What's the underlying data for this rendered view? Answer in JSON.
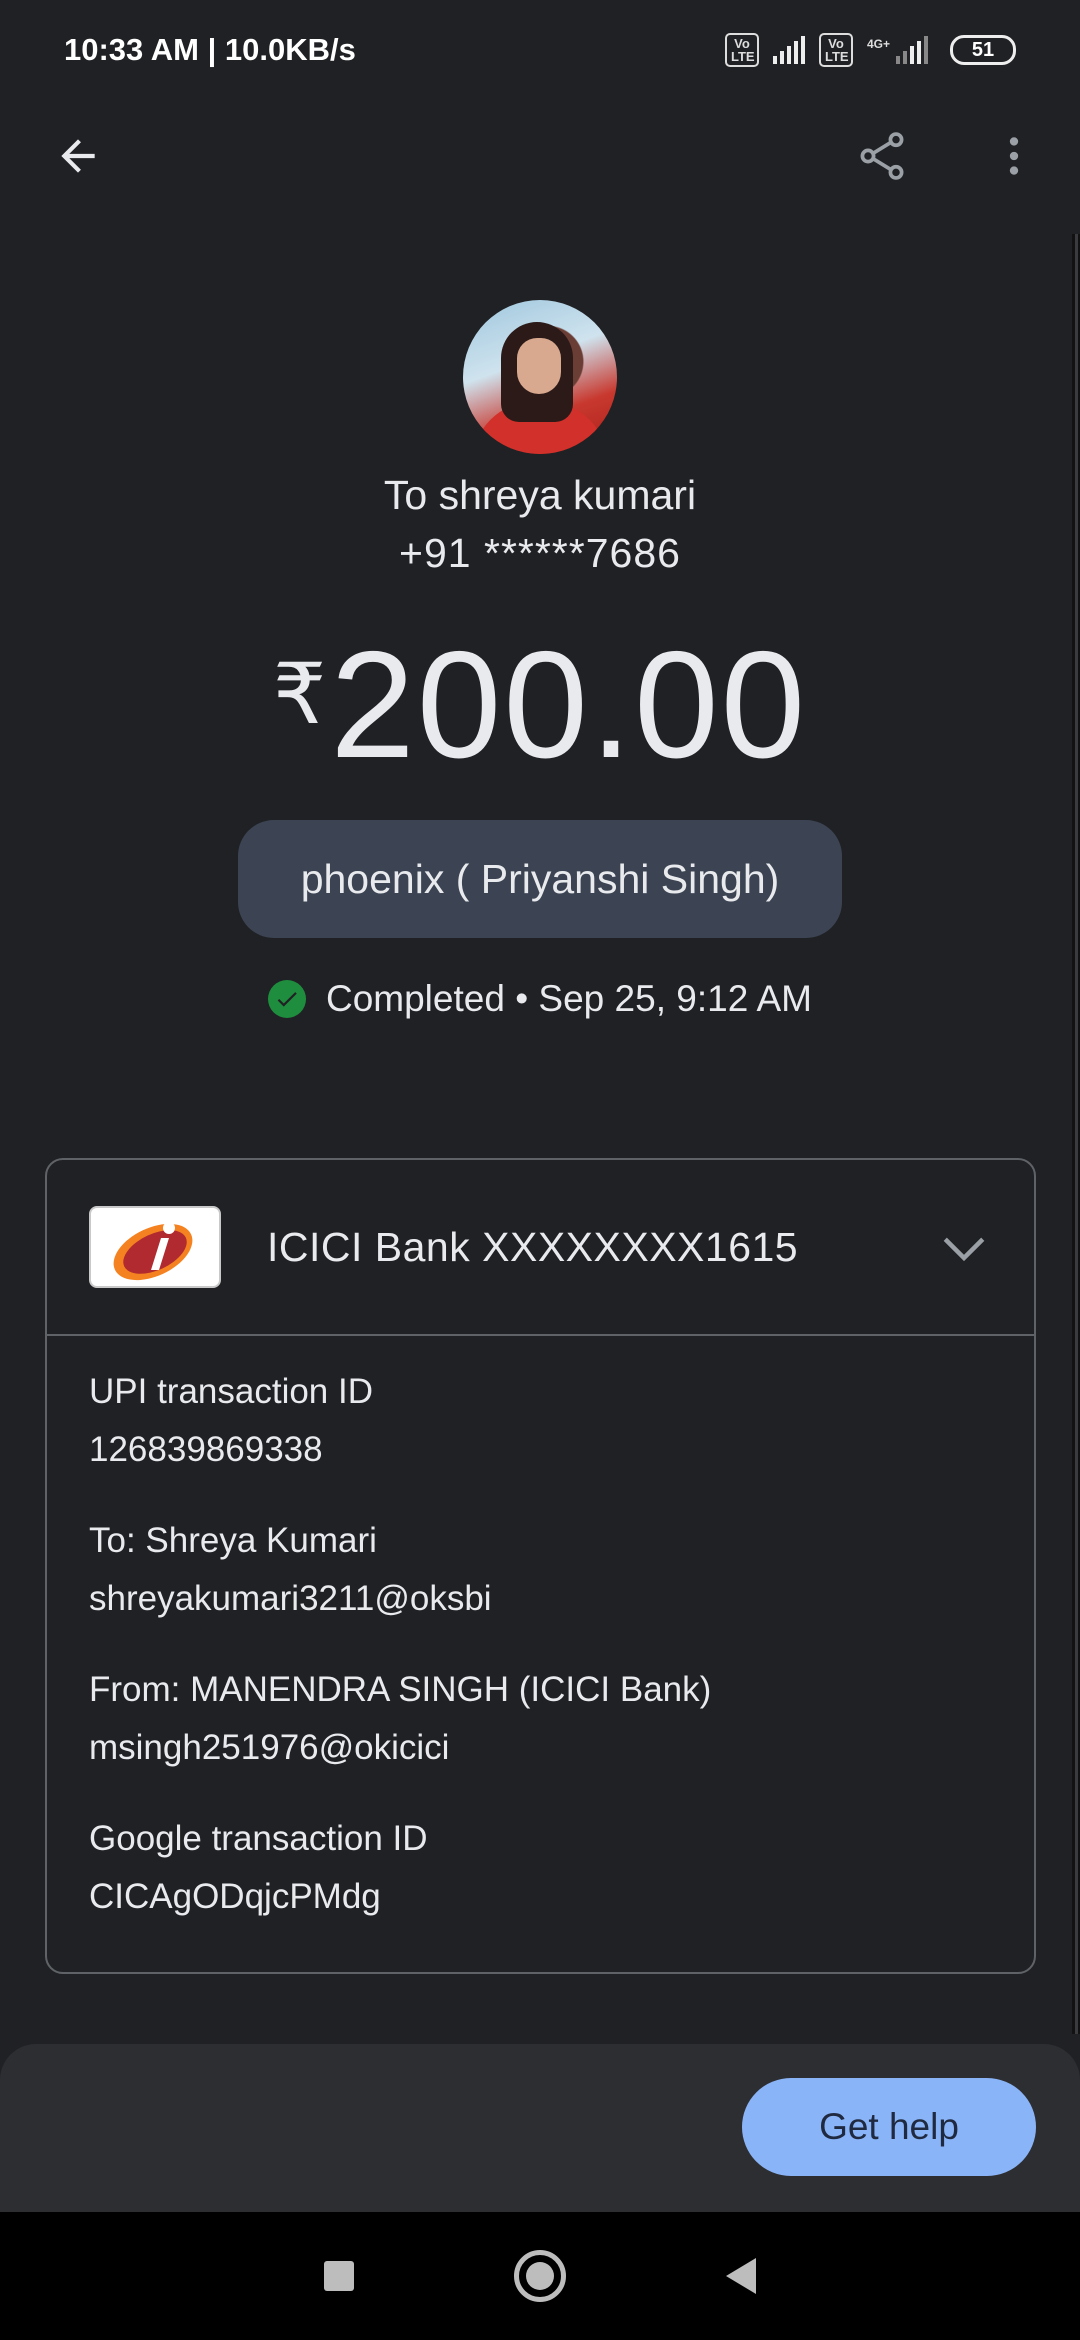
{
  "status_bar": {
    "time_speed": "10:33 AM | 10.0KB/s",
    "volte_1": "Vo LTE",
    "volte_2": "Vo LTE",
    "network": "4G+",
    "battery": "51"
  },
  "app_bar": {
    "back_icon": "arrow-back-icon",
    "share_icon": "share-icon",
    "more_icon": "more-vert-icon"
  },
  "recipient": {
    "name": "To shreya kumari",
    "phone": "+91 ******7686"
  },
  "payment": {
    "currency_symbol": "₹",
    "amount": "200.00",
    "note": "phoenix ( Priyanshi Singh)",
    "status": "Completed • Sep 25, 9:12 AM"
  },
  "card": {
    "bank_account": "ICICI Bank XXXXXXXX1615",
    "details": [
      {
        "label": "UPI transaction ID",
        "value": "126839869338"
      },
      {
        "label": "To: Shreya  Kumari",
        "value": "shreyakumari3211@oksbi"
      },
      {
        "label": "From: MANENDRA SINGH (ICICI Bank)",
        "value": "msingh251976@okicici"
      },
      {
        "label": "Google transaction ID",
        "value": "CICAgODqjcPMdg"
      }
    ]
  },
  "help_button": "Get help",
  "colors": {
    "background": "#202124",
    "accent_button": "#8ab4f8",
    "success": "#1e8e3e",
    "chip": "#3c4453"
  }
}
